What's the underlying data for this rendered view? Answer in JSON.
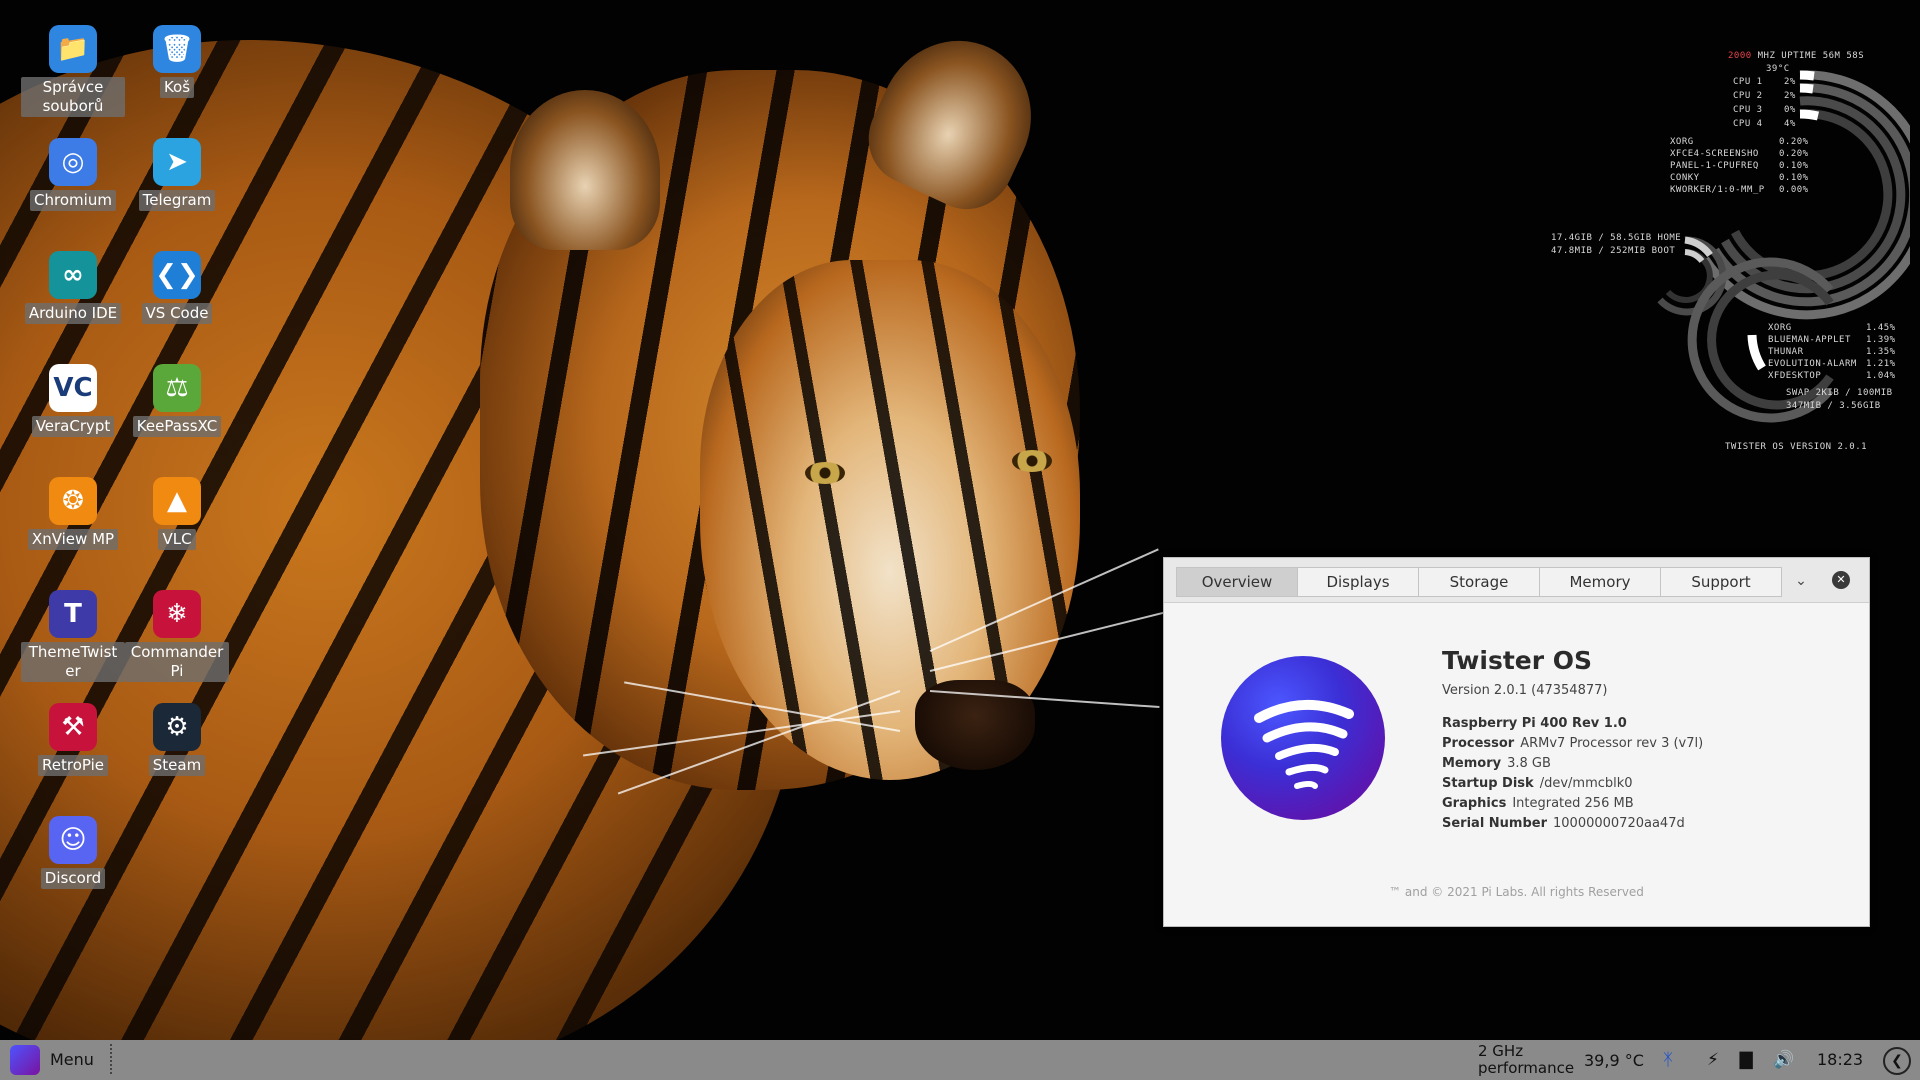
{
  "desktop": {
    "icons": [
      {
        "label": "Správce souborů",
        "icon": "folder-icon",
        "color": "#2f86e0"
      },
      {
        "label": "Koš",
        "icon": "trash-icon",
        "color": "#2f86e0"
      },
      {
        "label": "Chromium",
        "icon": "chromium-icon",
        "color": "#3d7be6"
      },
      {
        "label": "Telegram",
        "icon": "telegram-icon",
        "color": "#2aa3e0"
      },
      {
        "label": "Arduino IDE",
        "icon": "arduino-icon",
        "color": "#15939a"
      },
      {
        "label": "VS Code",
        "icon": "vscode-icon",
        "color": "#1f7fd6"
      },
      {
        "label": "VeraCrypt",
        "icon": "veracrypt-icon",
        "color": "#ffffff"
      },
      {
        "label": "KeePassXC",
        "icon": "keepassxc-icon",
        "color": "#5aa83a"
      },
      {
        "label": "XnView MP",
        "icon": "xnview-icon",
        "color": "#f08a10"
      },
      {
        "label": "VLC",
        "icon": "vlc-icon",
        "color": "#f08a10"
      },
      {
        "label": "ThemeTwister",
        "icon": "themetwister-icon",
        "color": "#3e3aa8"
      },
      {
        "label": "CommanderPi",
        "icon": "commanderpi-icon",
        "color": "#c7133c"
      },
      {
        "label": "RetroPie",
        "icon": "retropie-icon",
        "color": "#c7133c"
      },
      {
        "label": "Steam",
        "icon": "steam-icon",
        "color": "#1b2838"
      },
      {
        "label": "Discord",
        "icon": "discord-icon",
        "color": "#5865f2"
      }
    ]
  },
  "conky": {
    "header_mhz": "2000",
    "header_rest": "MHZ  UPTIME 56M 58S",
    "temp": "39°C",
    "cpus": [
      {
        "label": "CPU 1",
        "value": "2%"
      },
      {
        "label": "CPU 2",
        "value": "2%"
      },
      {
        "label": "CPU 3",
        "value": "0%"
      },
      {
        "label": "CPU 4",
        "value": "4%"
      }
    ],
    "cpu_procs": [
      {
        "name": "XORG",
        "value": "0.20%"
      },
      {
        "name": "XFCE4-SCREENSHO",
        "value": "0.20%"
      },
      {
        "name": "PANEL-1-CPUFREQ",
        "value": "0.10%"
      },
      {
        "name": "CONKY",
        "value": "0.10%"
      },
      {
        "name": "KWORKER/1:0-MM_P",
        "value": "0.00%"
      }
    ],
    "disks": [
      {
        "text": "17.4GIB / 58.5GIB HOME"
      },
      {
        "text": "47.8MIB / 252MIB BOOT"
      }
    ],
    "mem_procs": [
      {
        "name": "XORG",
        "value": "1.45%"
      },
      {
        "name": "BLUEMAN-APPLET",
        "value": "1.39%"
      },
      {
        "name": "THUNAR",
        "value": "1.35%"
      },
      {
        "name": "EVOLUTION-ALARM",
        "value": "1.21%"
      },
      {
        "name": "XFDESKTOP",
        "value": "1.04%"
      }
    ],
    "swap": "SWAP 2KIB / 100MIB",
    "ram": "347MIB / 3.56GIB",
    "version": "TWISTER OS VERSION 2.0.1",
    "accent": "#e8434b"
  },
  "about": {
    "tabs": [
      "Overview",
      "Displays",
      "Storage",
      "Memory",
      "Support"
    ],
    "active_tab": "Overview",
    "title": "Twister OS",
    "version": "Version 2.0.1 (47354877)",
    "device": "Raspberry Pi 400 Rev 1.0",
    "specs": [
      {
        "label": "Processor",
        "value": "ARMv7 Processor rev 3 (v7l)"
      },
      {
        "label": "Memory",
        "value": "3.8 GB"
      },
      {
        "label": "Startup Disk",
        "value": "/dev/mmcblk0"
      },
      {
        "label": "Graphics",
        "value": "Integrated 256 MB"
      },
      {
        "label": "Serial Number",
        "value": "10000000720aa47d"
      }
    ],
    "footer": "™ and © 2021 Pi Labs. All rights Reserved",
    "menu_icon": "chevron-down-icon",
    "close_icon": "close-icon"
  },
  "taskbar": {
    "menu_label": "Menu",
    "cpu_freq": "2 GHz",
    "cpu_governor": "performance",
    "temperature": "39,9 °C",
    "clock": "18:23",
    "tray_icons": [
      "bluetooth-icon",
      "battery-icon",
      "network-icon",
      "volume-icon"
    ]
  }
}
